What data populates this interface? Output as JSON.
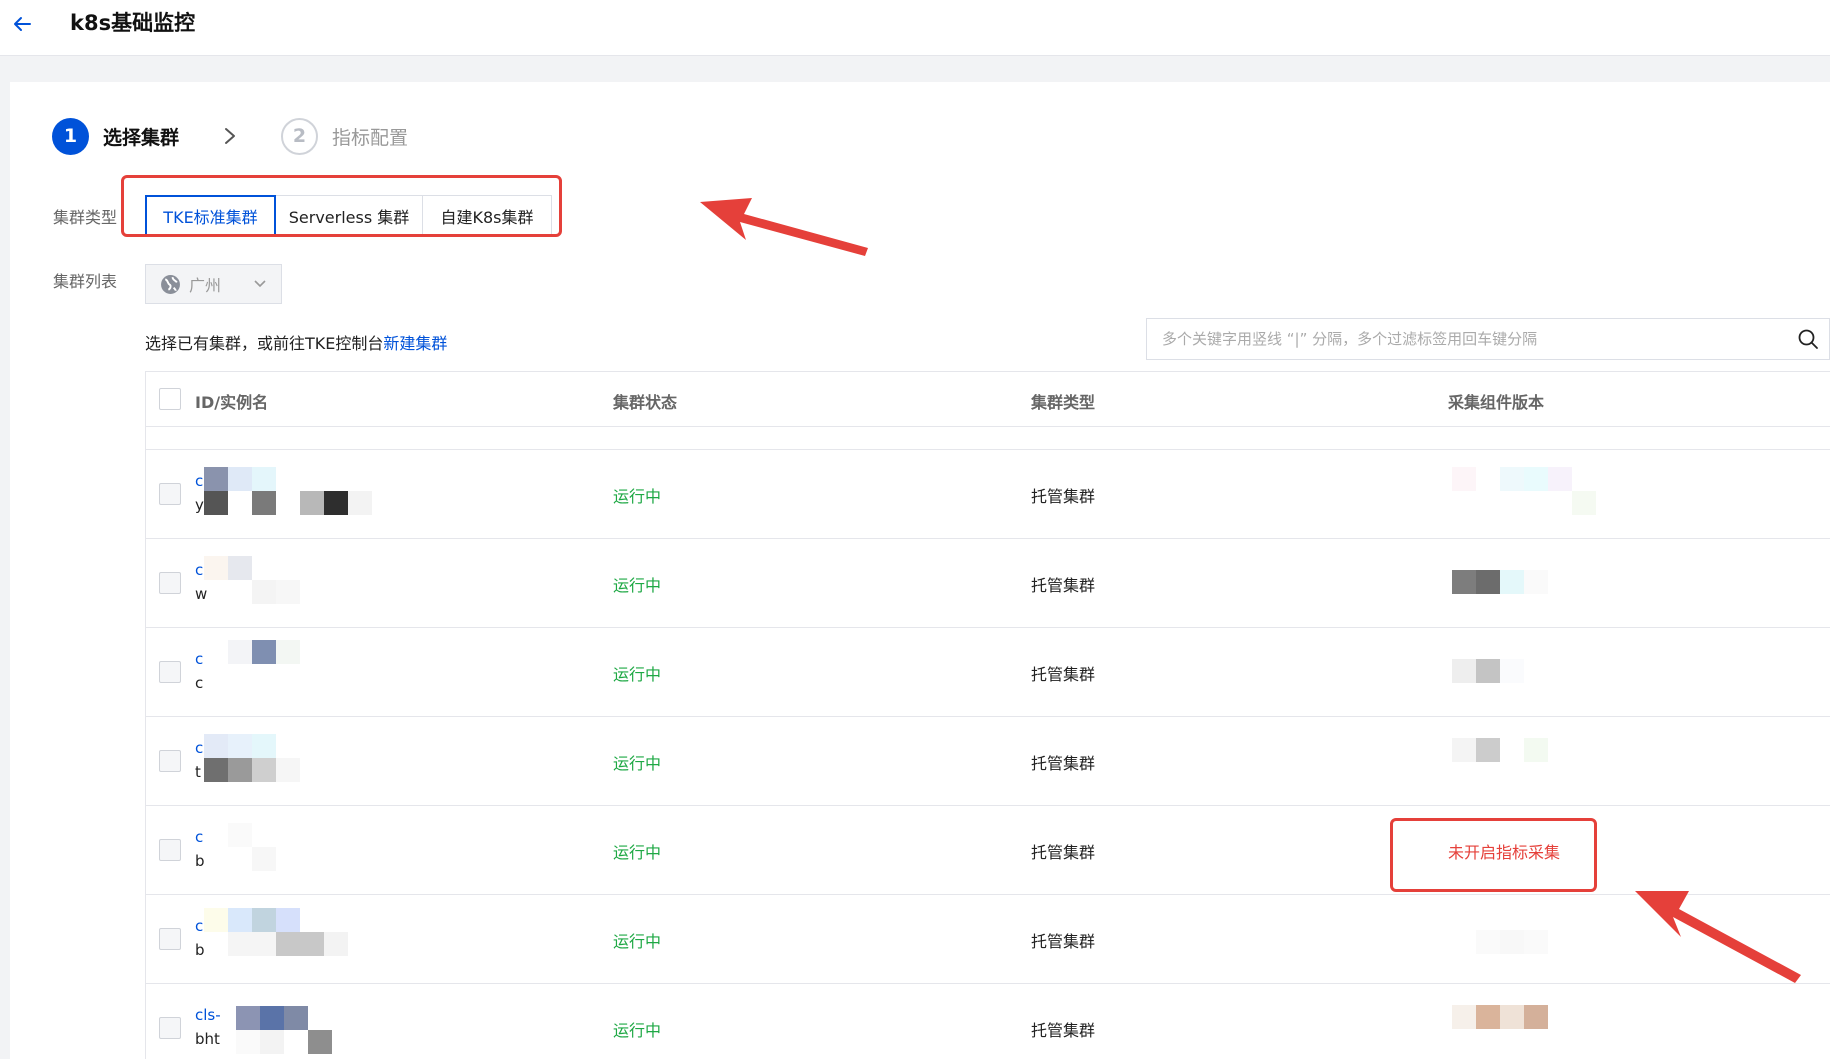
{
  "header": {
    "title": "k8s基础监控"
  },
  "steps": [
    {
      "num": "1",
      "label": "选择集群",
      "active": true
    },
    {
      "num": "2",
      "label": "指标配置",
      "active": false
    }
  ],
  "form": {
    "cluster_type_label": "集群类型",
    "cluster_list_label": "集群列表",
    "cluster_types": [
      "TKE标准集群",
      "Serverless 集群",
      "自建K8s集群"
    ],
    "region": "广州"
  },
  "hint": {
    "text": "选择已有集群，或前往TKE控制台",
    "link": "新建集群"
  },
  "search": {
    "placeholder": "多个关键字用竖线 “|” 分隔，多个过滤标签用回车键分隔"
  },
  "table": {
    "columns": [
      "ID/实例名",
      "集群状态",
      "集群类型",
      "采集组件版本"
    ],
    "rows": [
      {
        "id": "c",
        "name": "y",
        "status": "运行中",
        "type": "托管集群",
        "version": ""
      },
      {
        "id": "c",
        "name": "w",
        "status": "运行中",
        "type": "托管集群",
        "version": ""
      },
      {
        "id": "c",
        "name": "c",
        "status": "运行中",
        "type": "托管集群",
        "version": ""
      },
      {
        "id": "c",
        "name": "t",
        "status": "运行中",
        "type": "托管集群",
        "version": ""
      },
      {
        "id": "c",
        "name": "b",
        "status": "运行中",
        "type": "托管集群",
        "version": "未开启指标采集"
      },
      {
        "id": "c",
        "name": "b",
        "status": "运行中",
        "type": "托管集群",
        "version": ""
      },
      {
        "id": "cls-",
        "name": "bht",
        "status": "运行中",
        "type": "托管集群",
        "version": ""
      }
    ]
  },
  "colors": {
    "primary": "#0052d9",
    "running": "#1ea844",
    "alert": "#e5403a"
  },
  "icons": [
    "back-arrow-icon",
    "chevron-right-icon",
    "globe-icon",
    "chevron-down-icon",
    "search-icon",
    "annotation-arrow-icon"
  ]
}
